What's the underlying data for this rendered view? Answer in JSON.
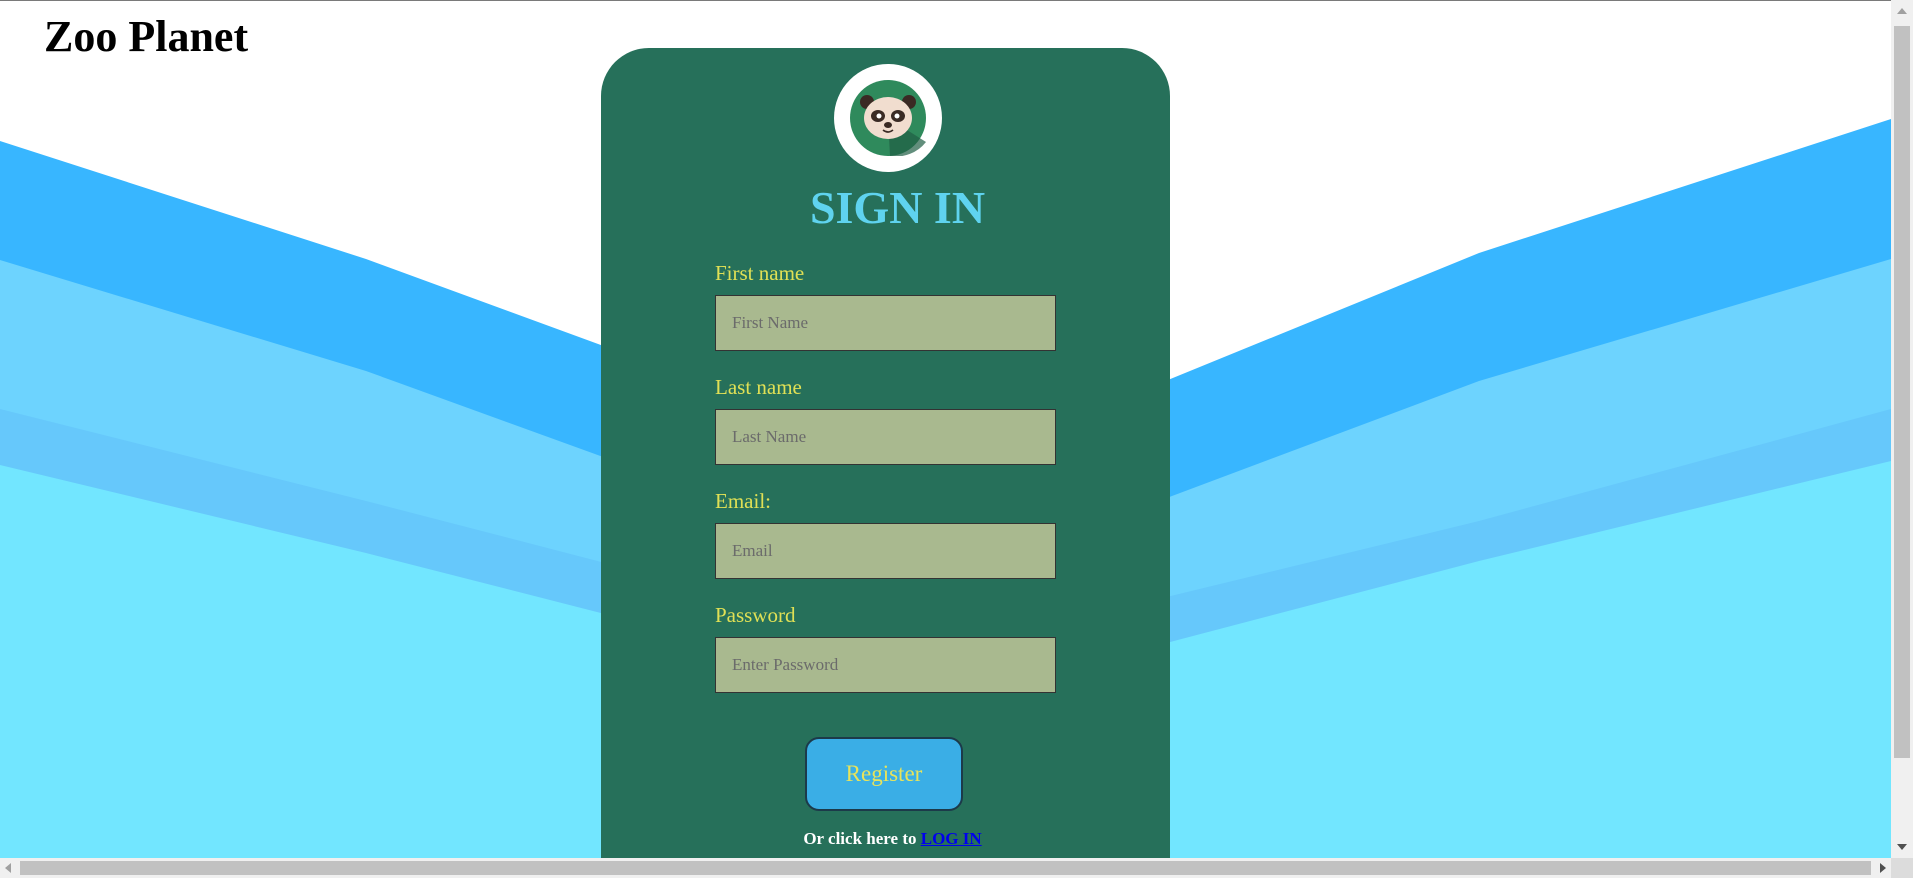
{
  "site": {
    "title": "Zoo Planet"
  },
  "form": {
    "heading": "SIGN IN",
    "fields": [
      {
        "label": "First name",
        "placeholder": "First Name",
        "value": ""
      },
      {
        "label": "Last name",
        "placeholder": "Last Name",
        "value": ""
      },
      {
        "label": "Email:",
        "placeholder": "Email",
        "value": ""
      },
      {
        "label": "Password",
        "placeholder": "Enter Password",
        "value": ""
      }
    ],
    "register_label": "Register",
    "login_prompt": "Or click here to",
    "login_link": "LOG IN"
  },
  "icons": {
    "avatar": "panda-icon"
  },
  "colors": {
    "card": "#26705a",
    "heading": "#5fd3ef",
    "label": "#e0e055",
    "input_bg": "#a9b98f",
    "button_bg": "#3aaee6",
    "wave_dark": "#38b6ff",
    "wave_mid": "#6dd3fe",
    "wave_light": "#72e6ff"
  }
}
